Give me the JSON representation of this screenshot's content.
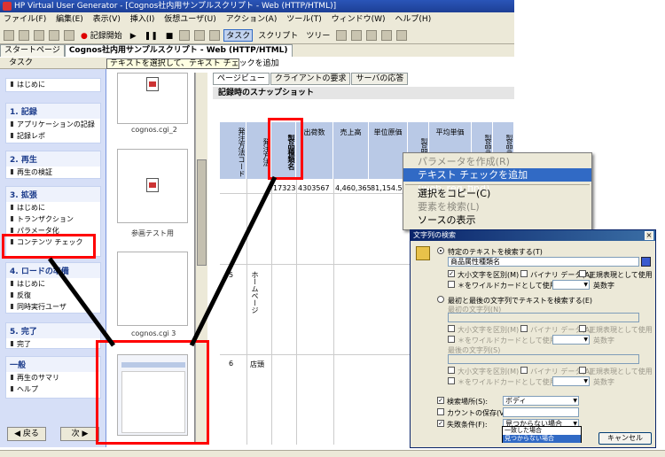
{
  "window": {
    "title": "HP Virtual User Generator - [Cognos社内用サンプルスクリプト - Web (HTTP/HTML)]"
  },
  "menu": [
    "ファイル(F)",
    "編集(E)",
    "表示(V)",
    "挿入(I)",
    "仮想ユーザ(U)",
    "アクション(A)",
    "ツール(T)",
    "ウィンドウ(W)",
    "ヘルプ(H)"
  ],
  "toolbar": {
    "record": "記録開始",
    "tasks": "タスク",
    "script": "スクリプト",
    "tree": "ツリー"
  },
  "doc_tabs": [
    "スタートページ",
    "Cognos社内用サンプルスクリプト - Web (HTTP/HTML)"
  ],
  "task_pane": {
    "header": "タスク",
    "sections": [
      {
        "items": [
          "はじめに"
        ]
      },
      {
        "title": "1. 記録",
        "items": [
          "アプリケーションの記録",
          "記録レポ"
        ]
      },
      {
        "title": "2. 再生",
        "items": [
          "再生の検証"
        ]
      },
      {
        "title": "3. 拡張",
        "items": [
          "はじめに",
          "トランザクション",
          "パラメータ化",
          "コンテンツ チェック"
        ]
      },
      {
        "title": "4. ロードの準備",
        "items": [
          "はじめに",
          "反復",
          "同時実行ユーザ"
        ]
      },
      {
        "title": "5. 完了",
        "items": [
          "完了"
        ]
      },
      {
        "title": "一般",
        "items": [
          "再生のサマリ",
          "ヘルプ"
        ]
      }
    ],
    "back": "戻る",
    "next": "次"
  },
  "tooltip": "テキストを選択して、テキスト チェックを追加",
  "thumbnails": [
    "cognos.cgi_2",
    "参画テスト用",
    "cognos.cgi 3"
  ],
  "snapshot_tabs": [
    "ページビュー",
    "クライアントの要求",
    "サーバの応答"
  ],
  "snapshot_title": "記録時のスナップショット",
  "table": {
    "headers": [
      "発注方法コード",
      "発注方法",
      "製品種類名",
      "出荷数",
      "売上高",
      "単位原価",
      "製品原価",
      "平均単価",
      "製品ライン",
      "製品ライン"
    ],
    "row1": {
      "qty": "17323",
      "amount": "4303567",
      "v1": "4,460,365",
      "v2": "81,154.52"
    },
    "row2": {
      "code": "5",
      "method": "ホームページ"
    },
    "row3": {
      "code": "6",
      "method": "店頭"
    }
  },
  "context_menu": {
    "items": [
      "パラメータを作成(R)",
      "テキスト チェックを追加 (web_reg_find)",
      "選択をコピー(C)",
      "要素を検索(L)",
      "ソースの表示"
    ]
  },
  "dialog": {
    "title": "文字列の検索",
    "opt1": "特定のテキストを検索する(T)",
    "search_text": "商品属性種類名",
    "case": "大小文字を区別(M)",
    "binary": "バイナリ データ(A)",
    "regex": "正規表現として使用",
    "wildcard": "＊をワイルドカードとして使用",
    "alnum": "英数字",
    "opt2": "最初と最後の文字列でテキストを検索する(E)",
    "left_label": "最初の文字列(N)",
    "right_label": "最後の文字列(S)",
    "scope_label": "検索場所(S):",
    "scope_value": "ボディ",
    "count_label": "カウントの保存(V):",
    "fail_label": "失敗条件(F):",
    "fail_value": "見つからない場合",
    "dropdown": [
      "一致した場合",
      "見つからない場合"
    ],
    "cancel": "キャンセル"
  }
}
